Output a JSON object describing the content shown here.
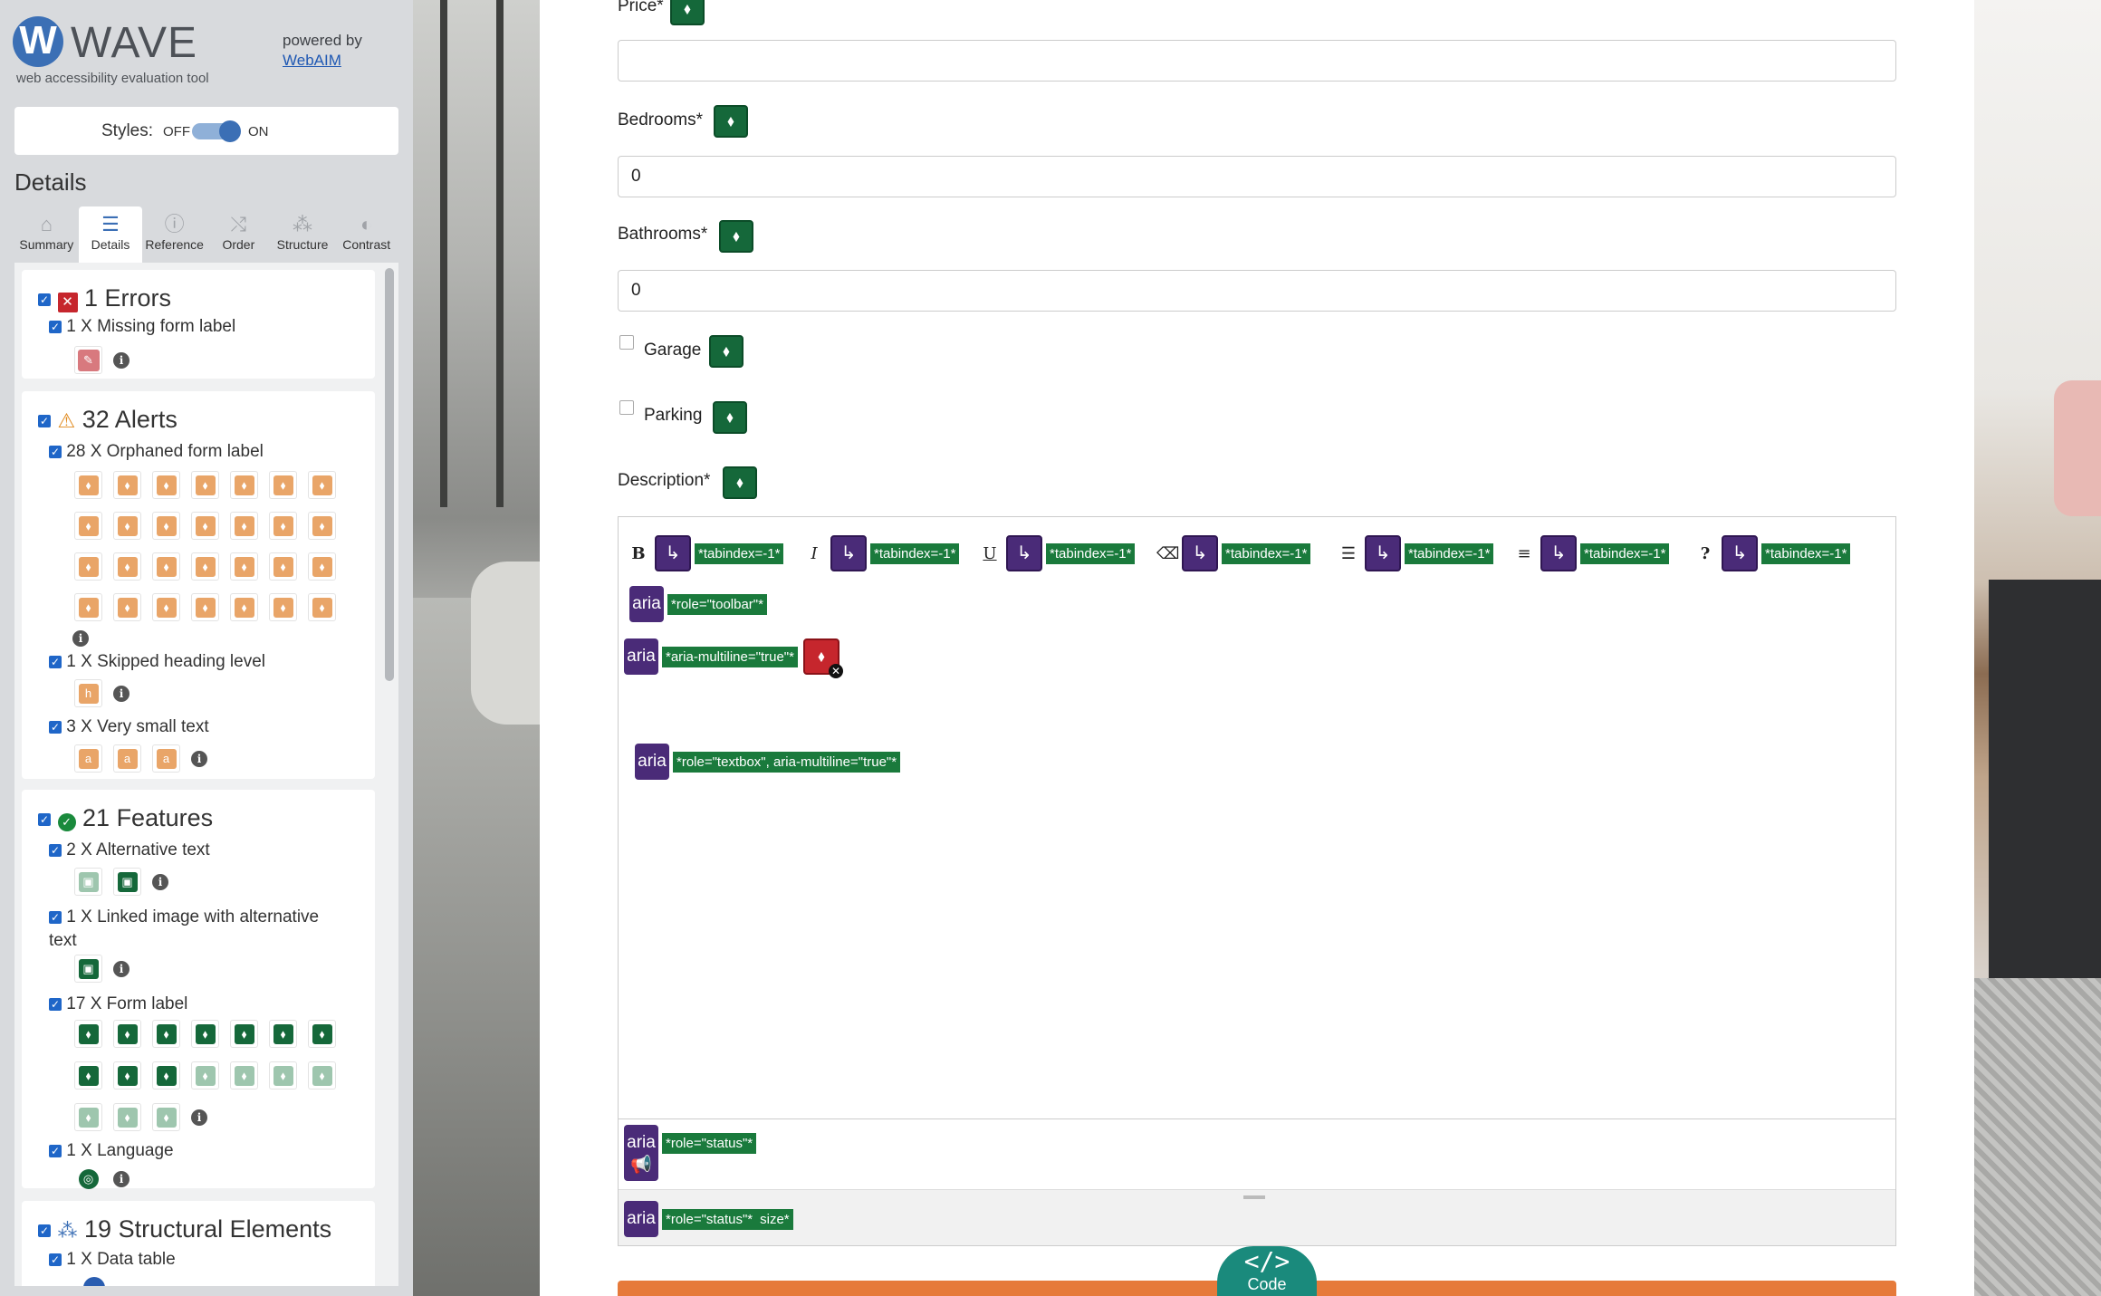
{
  "wave": {
    "logo_letter": "W",
    "logo_word": "WAVE",
    "tagline": "web accessibility evaluation tool",
    "powered_by": "powered by",
    "webaim": "WebAIM"
  },
  "styles": {
    "label": "Styles:",
    "off": "OFF",
    "on": "ON",
    "state": "on"
  },
  "details_title": "Details",
  "tabs": [
    {
      "label": "Summary",
      "icon": "home-icon"
    },
    {
      "label": "Details",
      "icon": "list-icon",
      "active": true
    },
    {
      "label": "Reference",
      "icon": "info-icon"
    },
    {
      "label": "Order",
      "icon": "order-icon"
    },
    {
      "label": "Structure",
      "icon": "structure-icon"
    },
    {
      "label": "Contrast",
      "icon": "contrast-icon"
    }
  ],
  "errors": {
    "heading": "1 Errors",
    "items": [
      {
        "label": "1 X Missing form label"
      }
    ]
  },
  "alerts": {
    "heading": "32 Alerts",
    "items": [
      {
        "label": "28 X Orphaned form label"
      },
      {
        "label": "1 X Skipped heading level"
      },
      {
        "label": "3 X Very small text"
      }
    ]
  },
  "features": {
    "heading": "21 Features",
    "items": [
      {
        "label": "2 X Alternative text"
      },
      {
        "label": "1 X Linked image with alternative"
      },
      {
        "label": "text"
      },
      {
        "label": "17 X Form label"
      },
      {
        "label": "1 X Language"
      }
    ]
  },
  "structural": {
    "heading": "19 Structural Elements",
    "items": [
      {
        "label": "1 X Data table"
      }
    ]
  },
  "form": {
    "price_label": "Price*",
    "bedrooms_label": "Bedrooms*",
    "bedrooms_value": "0",
    "bathrooms_label": "Bathrooms*",
    "bathrooms_value": "0",
    "garage_label": "Garage",
    "parking_label": "Parking",
    "description_label": "Description*"
  },
  "editor": {
    "toolbar": [
      {
        "glyph": "B",
        "tag": "*tabindex=-1*"
      },
      {
        "glyph": "I",
        "tag": "*tabindex=-1*"
      },
      {
        "glyph": "U",
        "tag": "*tabindex=-1*"
      },
      {
        "glyph": "⌫",
        "tag": "*tabindex=-1*"
      },
      {
        "glyph": "☰",
        "tag": "*tabindex=-1*"
      },
      {
        "glyph": "≡",
        "tag": "*tabindex=-1*"
      },
      {
        "glyph": "?",
        "tag": "*tabindex=-1*"
      }
    ],
    "aria_label": "aria",
    "toolbar_role": "*role=\"toolbar\"*",
    "multiline": "*aria-multiline=\"true\"*",
    "textbox_role": "*role=\"textbox\", aria-multiline=\"true\"*",
    "status_role": "*role=\"status\"*",
    "status_role2": "*role=\"status\"*",
    "size_text": "size*"
  },
  "code_button": {
    "symbol": "</>",
    "label": "Code"
  },
  "colors": {
    "error": "#c6262d",
    "alert": "#e9a568",
    "feature": "#15683a",
    "aria": "#4a2b78",
    "accent": "#3b6fb5",
    "orange": "#e67a3a",
    "teal": "#1a8a7c"
  }
}
